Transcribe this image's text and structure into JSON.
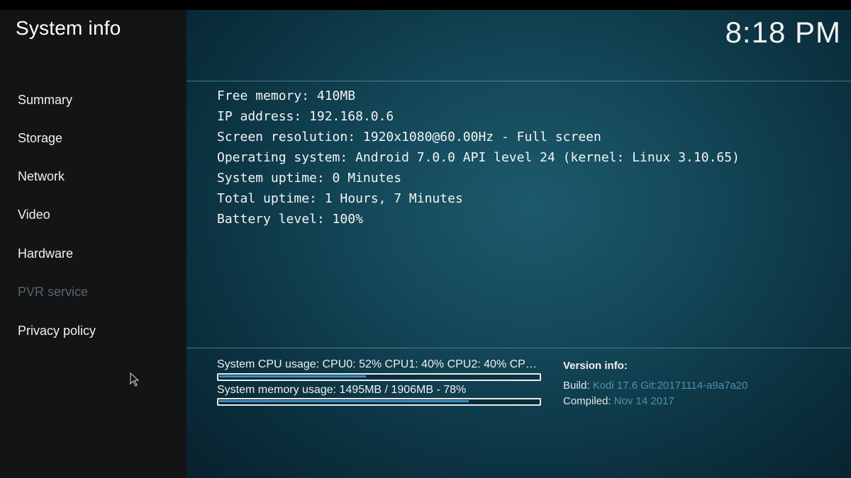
{
  "window": {
    "title": "System info",
    "clock": "8:18 PM"
  },
  "sidebar": {
    "items": [
      {
        "label": "Summary",
        "enabled": true
      },
      {
        "label": "Storage",
        "enabled": true
      },
      {
        "label": "Network",
        "enabled": true
      },
      {
        "label": "Video",
        "enabled": true
      },
      {
        "label": "Hardware",
        "enabled": true
      },
      {
        "label": "PVR service",
        "enabled": false
      },
      {
        "label": "Privacy policy",
        "enabled": true
      }
    ]
  },
  "summary": {
    "lines": [
      "Free memory: 410MB",
      "IP address: 192.168.0.6",
      "Screen resolution: 1920x1080@60.00Hz - Full screen",
      "Operating system: Android 7.0.0 API level 24 (kernel: Linux 3.10.65)",
      "System uptime: 0 Minutes",
      "Total uptime: 1 Hours, 7 Minutes",
      "Battery level: 100%"
    ]
  },
  "usage": {
    "cpu": {
      "label": "System CPU usage: CPU0:  52% CPU1:  40% CPU2:  40% CPU...",
      "percent": 46
    },
    "memory": {
      "label": "System memory usage: 1495MB / 1906MB - 78%",
      "percent": 78
    }
  },
  "version": {
    "title": "Version info:",
    "build_label": "Build:",
    "build_value": "Kodi 17.6 Git:20171114-a9a7a20",
    "compiled_label": "Compiled:",
    "compiled_value": "Nov 14 2017"
  },
  "colors": {
    "accent": "#3a8fc4",
    "sidebar_bg": "#121416",
    "disabled_text": "#5d6366",
    "version_value": "#4f8fb0"
  }
}
